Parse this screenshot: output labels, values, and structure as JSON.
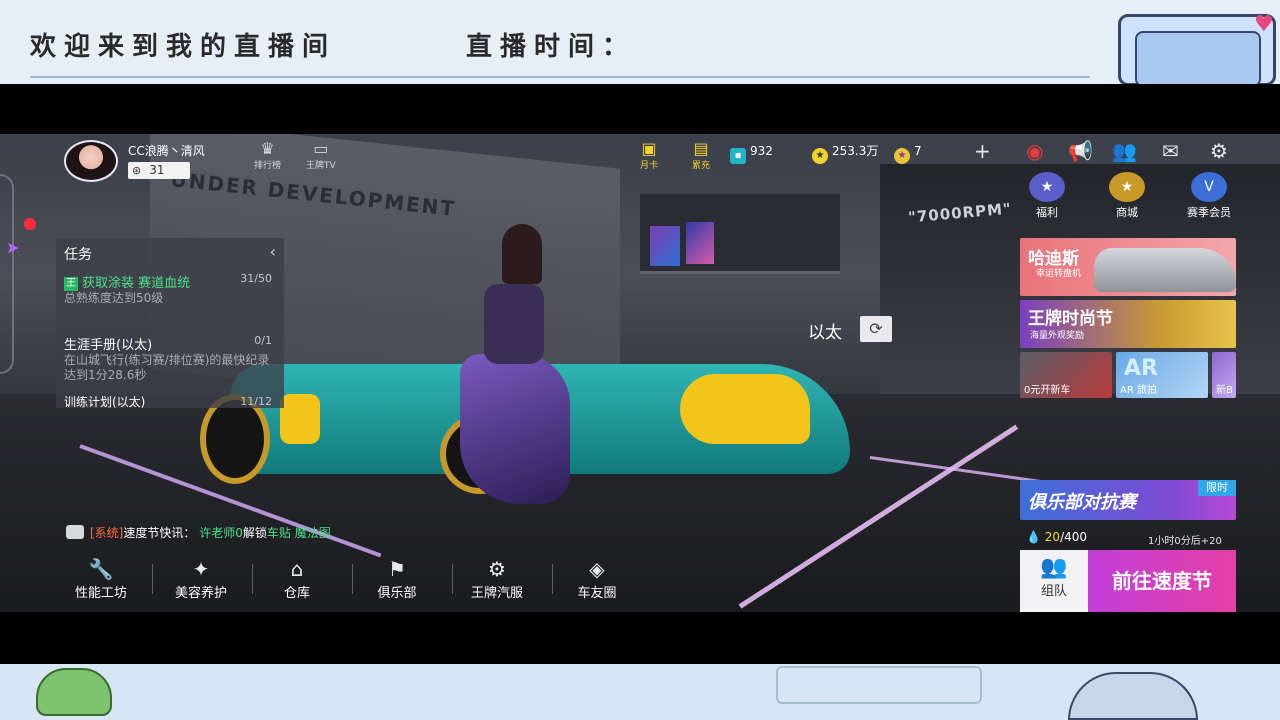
{
  "overlay": {
    "welcome": "欢迎来到我的直播间",
    "live_time_label": "直播时间："
  },
  "player": {
    "name": "CC浪腾丶清风",
    "level": "31"
  },
  "hud": {
    "ranking_label": "排行榜",
    "tv_label": "王牌TV",
    "monthly_card_label": "月卡",
    "recharge_label": "累充",
    "tickets": "932",
    "coins": "253.3万",
    "stars": "7"
  },
  "side_menu": {
    "welfare": "福利",
    "shop": "商城",
    "vip": "赛季会员"
  },
  "tasks": {
    "header": "任务",
    "items": [
      {
        "title": "获取涂装 赛道血统",
        "sub": "总熟练度达到50级",
        "count": "31/50",
        "tag": "王"
      },
      {
        "title": "生涯手册(以太)",
        "sub": "在山城飞行(练习赛/排位赛)的最快纪录达到1分28.6秒",
        "count": "0/1"
      },
      {
        "title": "训练计划(以太)",
        "sub": "",
        "count": "11/12"
      }
    ]
  },
  "car_name": "以太",
  "banners": {
    "hadis_title": "哈迪斯",
    "hadis_sub": "幸运转盘机",
    "ace_fashion_title": "王牌时尚节",
    "ace_fashion_sub": "海量外观奖励",
    "mini1": "0元开新车",
    "mini2": "AR 旅拍",
    "mini2_big": "AR",
    "mini3": "新B"
  },
  "club": {
    "title": "俱乐部对抗赛",
    "tag": "限时",
    "stamina_current": "20",
    "stamina_max": "/400",
    "stamina_timer": "1小时0分后+20",
    "team_label": "组队",
    "go_label": "前往速度节"
  },
  "chat": {
    "system": "[系统]",
    "prefix": "速度节快讯：",
    "name": "许老师0",
    "action": "解锁",
    "item": "车贴 魔法图"
  },
  "nav": [
    {
      "label": "性能工坊",
      "icon": "wrench-icon"
    },
    {
      "label": "美容养护",
      "icon": "spray-icon"
    },
    {
      "label": "仓库",
      "icon": "garage-icon"
    },
    {
      "label": "俱乐部",
      "icon": "club-icon"
    },
    {
      "label": "王牌汽服",
      "icon": "service-icon"
    },
    {
      "label": "车友圈",
      "icon": "friends-icon"
    }
  ]
}
